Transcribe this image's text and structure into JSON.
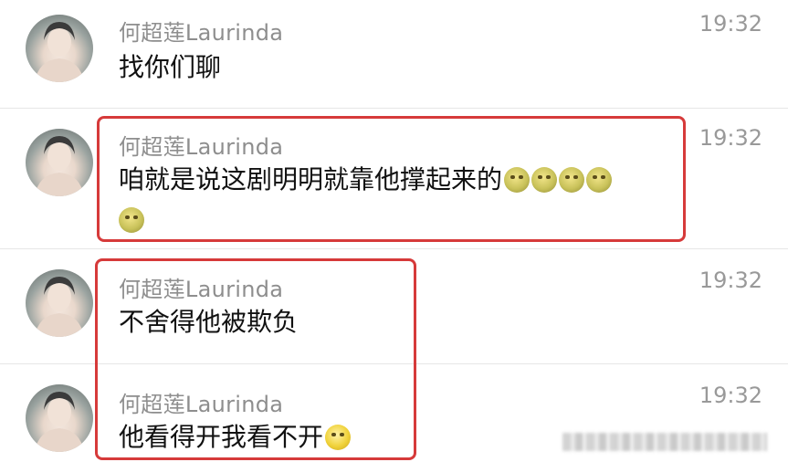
{
  "messages": [
    {
      "sender": "何超莲Laurinda",
      "time": "19:32",
      "text": "找你们聊",
      "emojis": []
    },
    {
      "sender": "何超莲Laurinda",
      "time": "19:32",
      "text": "咱就是说这剧明明就靠他撑起来的",
      "emojis": [
        "crying-face-icon",
        "crying-face-icon",
        "crying-face-icon",
        "crying-face-icon",
        "crying-face-icon"
      ]
    },
    {
      "sender": "何超莲Laurinda",
      "time": "19:32",
      "text": "不舍得他被欺负",
      "emojis": []
    },
    {
      "sender": "何超莲Laurinda",
      "time": "19:32",
      "text": "他看得开我看不开",
      "emojis": [
        "laughing-tears-icon"
      ]
    }
  ],
  "colors": {
    "highlight": "#d63a3a",
    "sender": "#8e8e8e",
    "time": "#999999",
    "text": "#111111"
  }
}
